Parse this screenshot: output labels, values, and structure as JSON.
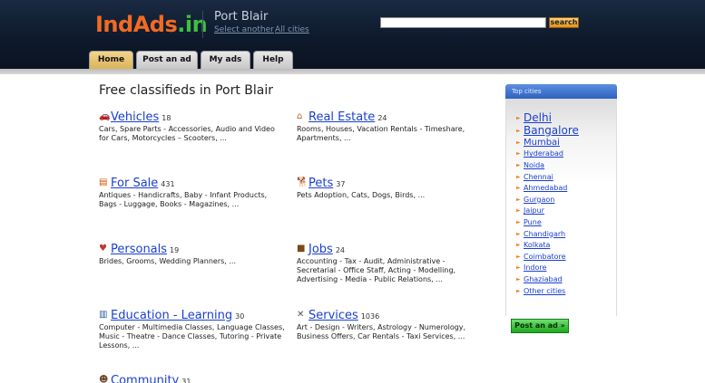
{
  "header": {
    "logo_part1": "IndAds",
    "logo_part2": ".in",
    "city": "Port Blair",
    "select_another": "Select another",
    "all_cities": "All cities",
    "search_placeholder": "",
    "search_button": "search"
  },
  "tabs": [
    {
      "label": "Home",
      "active": true
    },
    {
      "label": "Post an ad",
      "active": false
    },
    {
      "label": "My ads",
      "active": false
    },
    {
      "label": "Help",
      "active": false
    }
  ],
  "main": {
    "title": "Free classifieds in Port Blair",
    "categories": [
      {
        "name": "Vehicles",
        "count": "18",
        "icon": "car-icon",
        "desc": "Cars, Spare Parts - Accessories, Audio and Video for Cars, Motorcycles – Scooters, ..."
      },
      {
        "name": "Real Estate",
        "count": "24",
        "icon": "house-icon",
        "desc": "Rooms, Houses, Vacation Rentals - Timeshare, Apartments, ..."
      },
      {
        "name": "For Sale",
        "count": "431",
        "icon": "sale-icon",
        "desc": "Antiques - Handicrafts, Baby - Infant Products, Bags - Luggage, Books - Magazines, ..."
      },
      {
        "name": "Pets",
        "count": "37",
        "icon": "dog-icon",
        "desc": "Pets Adoption, Cats, Dogs, Birds, ..."
      },
      {
        "name": "Personals",
        "count": "19",
        "icon": "heart-icon",
        "desc": "Brides, Grooms, Wedding Planners, ..."
      },
      {
        "name": "Jobs",
        "count": "24",
        "icon": "briefcase-icon",
        "desc": "Accounting - Tax - Audit, Administrative - Secretarial - Office Staff, Acting - Modelling, Advertising - Media - Public Relations, ..."
      },
      {
        "name": "Education - Learning",
        "count": "30",
        "icon": "book-icon",
        "desc": "Computer - Multimedia Classes, Language Classes, Music - Theatre - Dance Classes, Tutoring - Private Lessons, ..."
      },
      {
        "name": "Services",
        "count": "1036",
        "icon": "tools-icon",
        "desc": "Art - Design - Writers, Astrology - Numerology, Business Offers, Car Rentals - Taxi Services, ..."
      },
      {
        "name": "Community",
        "count": "31",
        "icon": "people-icon",
        "desc": ""
      }
    ]
  },
  "sidebar": {
    "title": "Top cities",
    "cities": [
      "Delhi",
      "Bangalore",
      "Mumbai",
      "Hyderabad",
      "Noida",
      "Chennai",
      "Ahmedabad",
      "Gurgaon",
      "Jaipur",
      "Pune",
      "Chandigarh",
      "Kolkata",
      "Coimbatore",
      "Indore",
      "Ghaziabad",
      "Other cities"
    ],
    "post_ad_button": "Post an ad »"
  },
  "colors": {
    "header_bg": "#0e1a2c",
    "logo_orange": "#f26a22",
    "logo_green": "#3fbf3f",
    "link_blue": "#1a3fd0",
    "sidebar_header": "#2f62c0",
    "post_button_green": "#1ea81e"
  }
}
